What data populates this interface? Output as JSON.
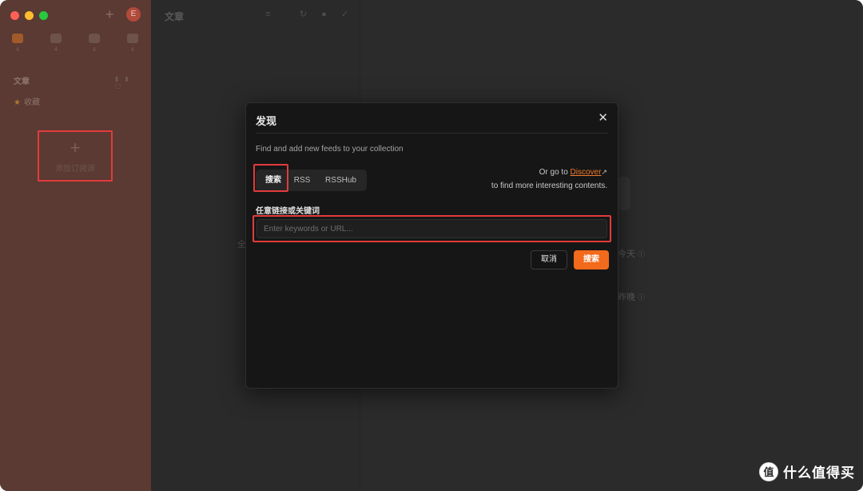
{
  "sidebar": {
    "add_icon": "plus-icon",
    "avatar_initial": "E",
    "views": [
      {
        "name": "articles-icon",
        "count": "4"
      },
      {
        "name": "twitter-icon",
        "count": "4"
      },
      {
        "name": "pictures-icon",
        "count": "4"
      },
      {
        "name": "videos-icon",
        "count": "4"
      }
    ],
    "section_title": "文章",
    "favorites_label": "收藏",
    "add_subscription_label": "添加订阅源"
  },
  "list": {
    "title": "文章",
    "toolbar_icons": [
      "menu-icon",
      "refresh-icon",
      "dot-icon",
      "check-circle-icon"
    ]
  },
  "background": {
    "left_hint": "全",
    "today": "今天",
    "last_night": "昨晚"
  },
  "modal": {
    "title": "发现",
    "subtitle": "Find and add new feeds to your collection",
    "tabs": [
      "搜索",
      "RSS",
      "RSSHub"
    ],
    "active_tab": "搜索",
    "goto_prefix": "Or go to ",
    "goto_link": "Discover",
    "goto_suffix": "to find more interesting contents.",
    "field_label": "任意链接或关键词",
    "field_placeholder": "Enter keywords or URL...",
    "field_value": "",
    "cancel_label": "取消",
    "search_label": "搜索"
  },
  "watermark": {
    "logo": "值",
    "text": "什么值得买"
  },
  "colors": {
    "accent": "#f26a1b",
    "highlight_box": "#e23b3b",
    "sidebar_bg": "#5a3a33",
    "modal_bg": "#161616"
  }
}
